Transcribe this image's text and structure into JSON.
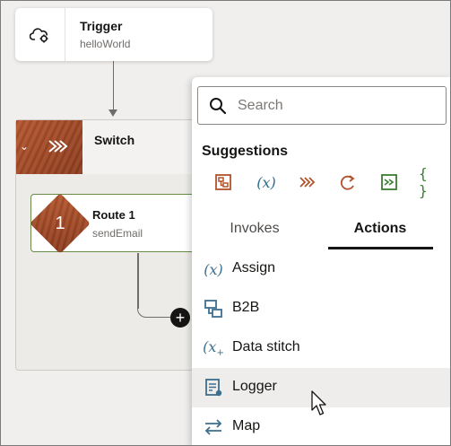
{
  "trigger": {
    "title": "Trigger",
    "subtitle": "helloWorld",
    "icon": "cloud-gear-icon"
  },
  "switch": {
    "title": "Switch",
    "icon": "switch-icon"
  },
  "route": {
    "number": "1",
    "title": "Route 1",
    "subtitle": "sendEmail"
  },
  "add_button": {
    "glyph": "+"
  },
  "search": {
    "placeholder": "Search",
    "value": ""
  },
  "suggestions": {
    "label": "Suggestions",
    "icons": [
      "b2b-icon",
      "assign-icon",
      "switch-icon",
      "for-each-icon",
      "scope-icon",
      "json-icon"
    ]
  },
  "tabs": [
    {
      "label": "Invokes",
      "selected": false
    },
    {
      "label": "Actions",
      "selected": true
    }
  ],
  "actions": [
    {
      "label": "Assign",
      "icon": "assign-icon"
    },
    {
      "label": "B2B",
      "icon": "b2b-icon"
    },
    {
      "label": "Data stitch",
      "icon": "data-stitch-icon"
    },
    {
      "label": "Logger",
      "icon": "logger-icon",
      "hovered": true
    },
    {
      "label": "Map",
      "icon": "map-icon"
    }
  ],
  "colors": {
    "canvas": "#f1efed",
    "switch_tile": "#a34a26",
    "suggestion_orange": "#b0532c",
    "suggestion_blue": "#2f6c8f",
    "suggestion_green": "#3a7d32",
    "route_border": "#6a8c48",
    "action_icon": "#3d6f8e"
  }
}
